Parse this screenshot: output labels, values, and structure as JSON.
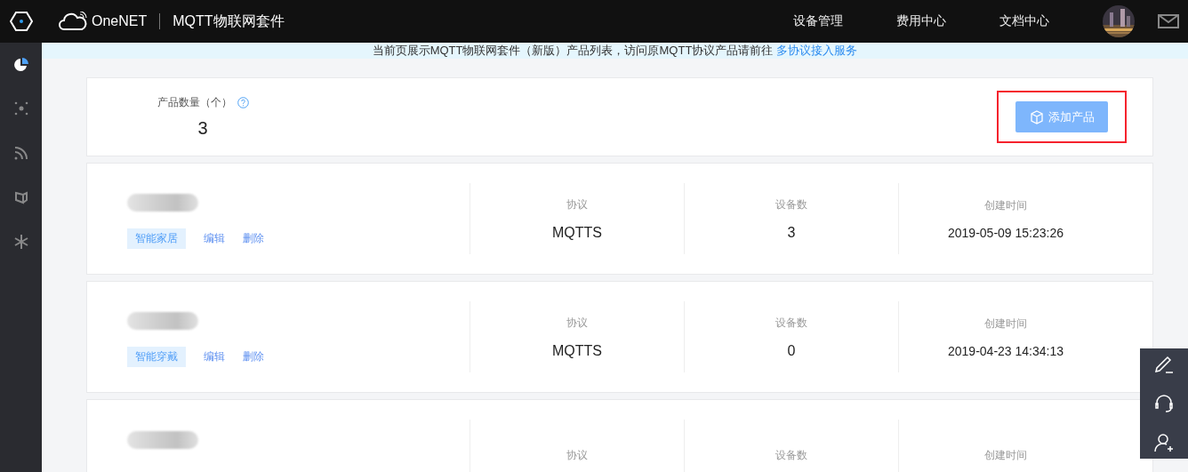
{
  "header": {
    "logo": "OneNET",
    "product_title": "MQTT物联网套件",
    "nav": [
      {
        "label": "设备管理"
      },
      {
        "label": "费用中心"
      },
      {
        "label": "文档中心"
      }
    ]
  },
  "sidebar": {
    "items": [
      {
        "kind": "pie",
        "selected": true
      },
      {
        "kind": "dots",
        "selected": false
      },
      {
        "kind": "signal",
        "selected": false
      },
      {
        "kind": "cube",
        "selected": false
      },
      {
        "kind": "asterisk",
        "selected": false
      }
    ]
  },
  "notice": {
    "text": "当前页展示MQTT物联网套件（新版）产品列表，访问原MQTT协议产品请前往",
    "link": "多协议接入服务"
  },
  "summary": {
    "label": "产品数量（个）",
    "count": "3",
    "add_button": "添加产品",
    "highlighted": true
  },
  "products": [
    {
      "tag": "智能家居",
      "actions": [
        "编辑",
        "删除"
      ],
      "fields": [
        {
          "label": "协议",
          "value": "MQTTS"
        },
        {
          "label": "设备数",
          "value": "3"
        },
        {
          "label": "创建时间",
          "value": "2019-05-09 15:23:26"
        }
      ]
    },
    {
      "tag": "智能穿戴",
      "actions": [
        "编辑",
        "删除"
      ],
      "fields": [
        {
          "label": "协议",
          "value": "MQTTS"
        },
        {
          "label": "设备数",
          "value": "0"
        },
        {
          "label": "创建时间",
          "value": "2019-04-23 14:34:13"
        }
      ]
    },
    {
      "fields": [
        {
          "label": "协议"
        },
        {
          "label": "设备数"
        },
        {
          "label": "创建时间"
        }
      ]
    }
  ],
  "float_tools": [
    {
      "kind": "edit"
    },
    {
      "kind": "support"
    },
    {
      "kind": "add-user"
    }
  ]
}
